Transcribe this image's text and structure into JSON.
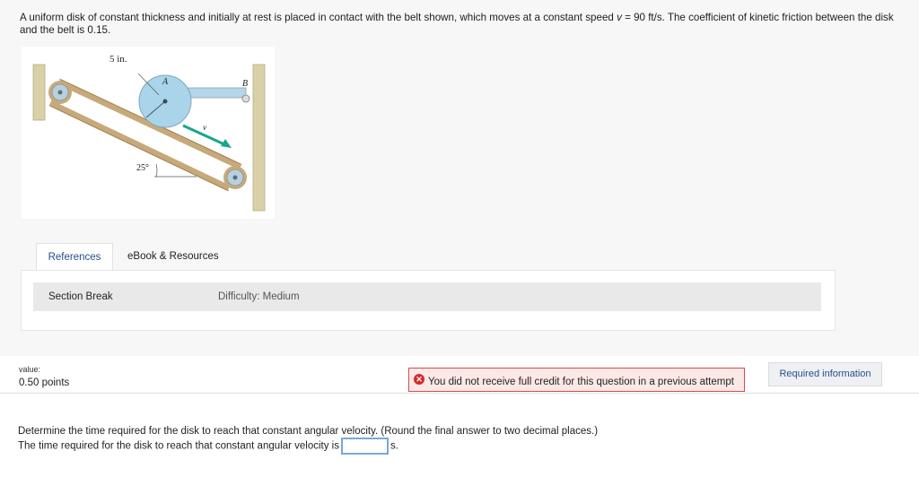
{
  "problem": {
    "statement_start": "A uniform disk of constant thickness and initially at rest is placed in contact with the belt shown, which moves at a constant speed ",
    "speed_var": "v",
    "statement_end": " = 90 ft/s. The coefficient of kinetic friction between the disk and the belt is 0.15."
  },
  "figure": {
    "radius_label": "5 in.",
    "disk_label": "A",
    "pivot_label": "B",
    "velocity_label": "v",
    "angle_label": "25°",
    "colors": {
      "belt": "#c7a97a",
      "disk": "#a9d4ea",
      "arrow": "#17a88a",
      "wall": "#d9d0a8"
    }
  },
  "tabs": {
    "references": "References",
    "ebook": "eBook & Resources"
  },
  "section": {
    "title": "Section Break",
    "difficulty": "Difficulty: Medium"
  },
  "scoring": {
    "value_label": "value:",
    "points": "0.50 points"
  },
  "alert": {
    "message": "You did not receive full credit for this question in a previous attempt",
    "icon": "x-circle-icon"
  },
  "required_button": "Required information",
  "question": {
    "prompt": "Determine the time required for the disk to reach that constant angular velocity. (Round the final answer to two decimal places.)",
    "answer_prefix": "The time required for the disk to reach that constant angular velocity is",
    "answer_value": "",
    "answer_unit": "s."
  }
}
